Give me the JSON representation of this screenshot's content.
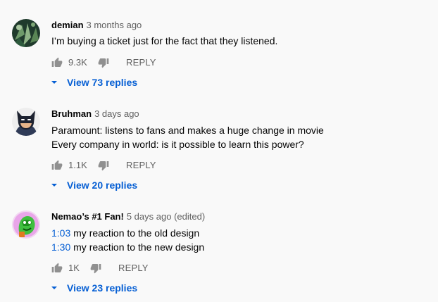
{
  "comments": [
    {
      "author": "demian",
      "time": "3 months ago",
      "edited": "",
      "lines": [
        "I’m buying a ticket just for the fact that they listened."
      ],
      "likes": "9.3K",
      "reply_label": "REPLY",
      "view_replies": "View 73 replies",
      "avatar_icon": "leaf-pattern-avatar"
    },
    {
      "author": "Bruhman",
      "time": "3 days ago",
      "edited": "",
      "lines": [
        "Paramount: listens to fans and makes a huge change in movie",
        "Every company in world: is it possible to learn this power?"
      ],
      "likes": "1.1K",
      "reply_label": "REPLY",
      "view_replies": "View 20 replies",
      "avatar_icon": "batman-avatar"
    },
    {
      "author": "Nemao’s #1 Fan!",
      "time": "5 days ago",
      "edited": "(edited)",
      "line1_ts": "1:03",
      "line1_text": " my reaction to the old design",
      "line2_ts": "1:30",
      "line2_text": " my reaction to the new design",
      "likes": "1K",
      "reply_label": "REPLY",
      "view_replies": "View 23 replies",
      "avatar_icon": "green-cartoon-avatar"
    }
  ],
  "colors": {
    "background": "#f9f9f9",
    "link_blue": "#065fd4",
    "secondary_text": "#606060",
    "icon_gray": "#909090"
  }
}
